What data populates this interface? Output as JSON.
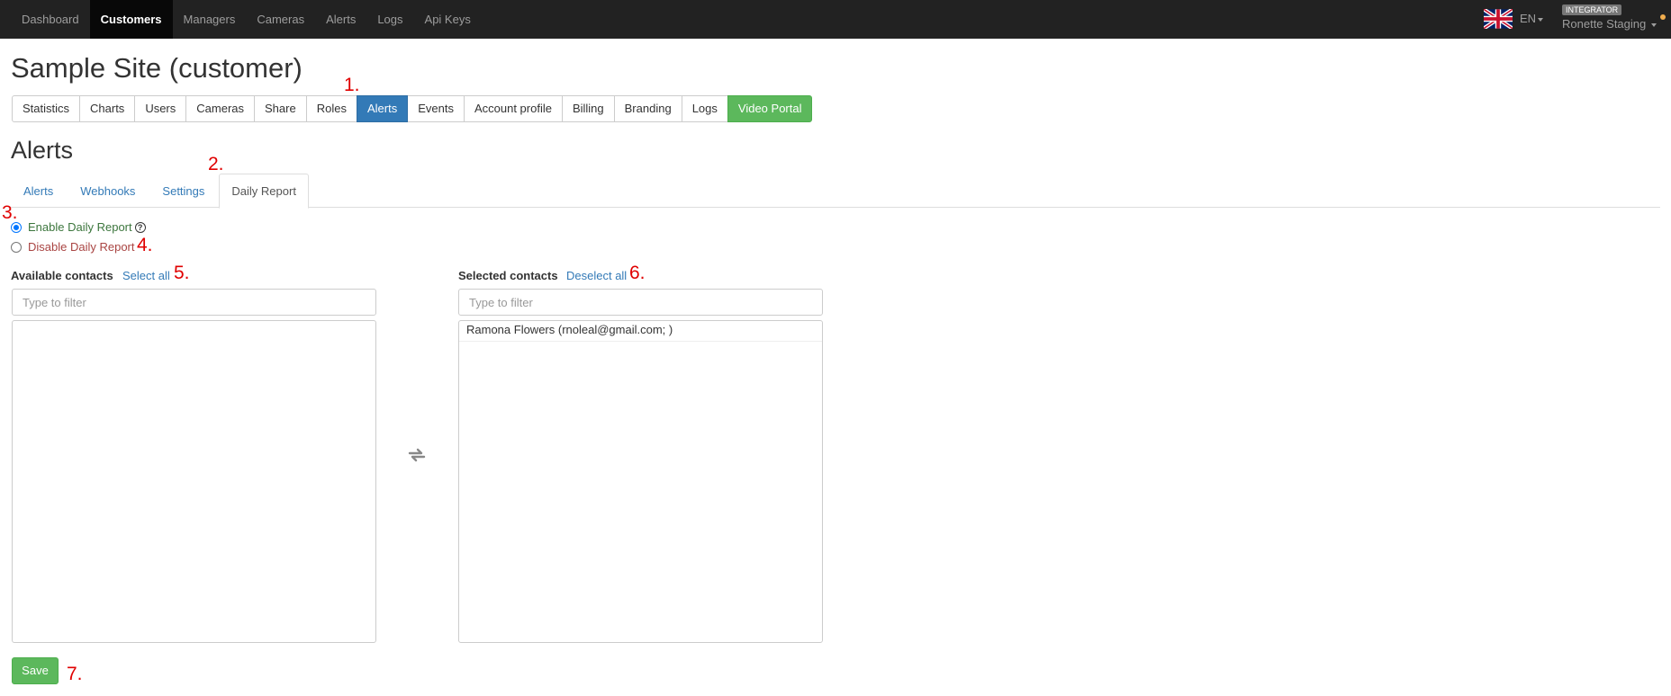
{
  "navbar": {
    "items": [
      {
        "label": "Dashboard",
        "active": false
      },
      {
        "label": "Customers",
        "active": true
      },
      {
        "label": "Managers",
        "active": false
      },
      {
        "label": "Cameras",
        "active": false
      },
      {
        "label": "Alerts",
        "active": false
      },
      {
        "label": "Logs",
        "active": false
      },
      {
        "label": "Api Keys",
        "active": false
      }
    ],
    "language": "EN",
    "role_badge": "INTEGRATOR",
    "user_name": "Ronette Staging"
  },
  "page": {
    "title": "Sample Site (customer)"
  },
  "button_group": {
    "items": [
      {
        "label": "Statistics"
      },
      {
        "label": "Charts"
      },
      {
        "label": "Users"
      },
      {
        "label": "Cameras"
      },
      {
        "label": "Share"
      },
      {
        "label": "Roles"
      },
      {
        "label": "Alerts",
        "active": true
      },
      {
        "label": "Events"
      },
      {
        "label": "Account profile"
      },
      {
        "label": "Billing"
      },
      {
        "label": "Branding"
      },
      {
        "label": "Logs"
      },
      {
        "label": "Video Portal",
        "success": true
      }
    ]
  },
  "section": {
    "title": "Alerts"
  },
  "tabs": {
    "items": [
      {
        "label": "Alerts"
      },
      {
        "label": "Webhooks"
      },
      {
        "label": "Settings"
      },
      {
        "label": "Daily Report",
        "active": true
      }
    ]
  },
  "daily_report": {
    "enable_label": "Enable Daily Report",
    "disable_label": "Disable Daily Report",
    "enabled": true,
    "help_glyph": "?"
  },
  "available": {
    "label": "Available contacts",
    "select_all": "Select all",
    "filter_placeholder": "Type to filter",
    "items": []
  },
  "selected": {
    "label": "Selected contacts",
    "deselect_all": "Deselect all",
    "filter_placeholder": "Type to filter",
    "items": [
      "Ramona Flowers (rnoleal@gmail.com; )"
    ]
  },
  "save_label": "Save",
  "annotations": [
    "1.",
    "2.",
    "3.",
    "4.",
    "5.",
    "6.",
    "7."
  ],
  "colors": {
    "navbar_bg": "#222222",
    "primary": "#337ab7",
    "success": "#5cb85c",
    "annotation": "#e00000"
  }
}
